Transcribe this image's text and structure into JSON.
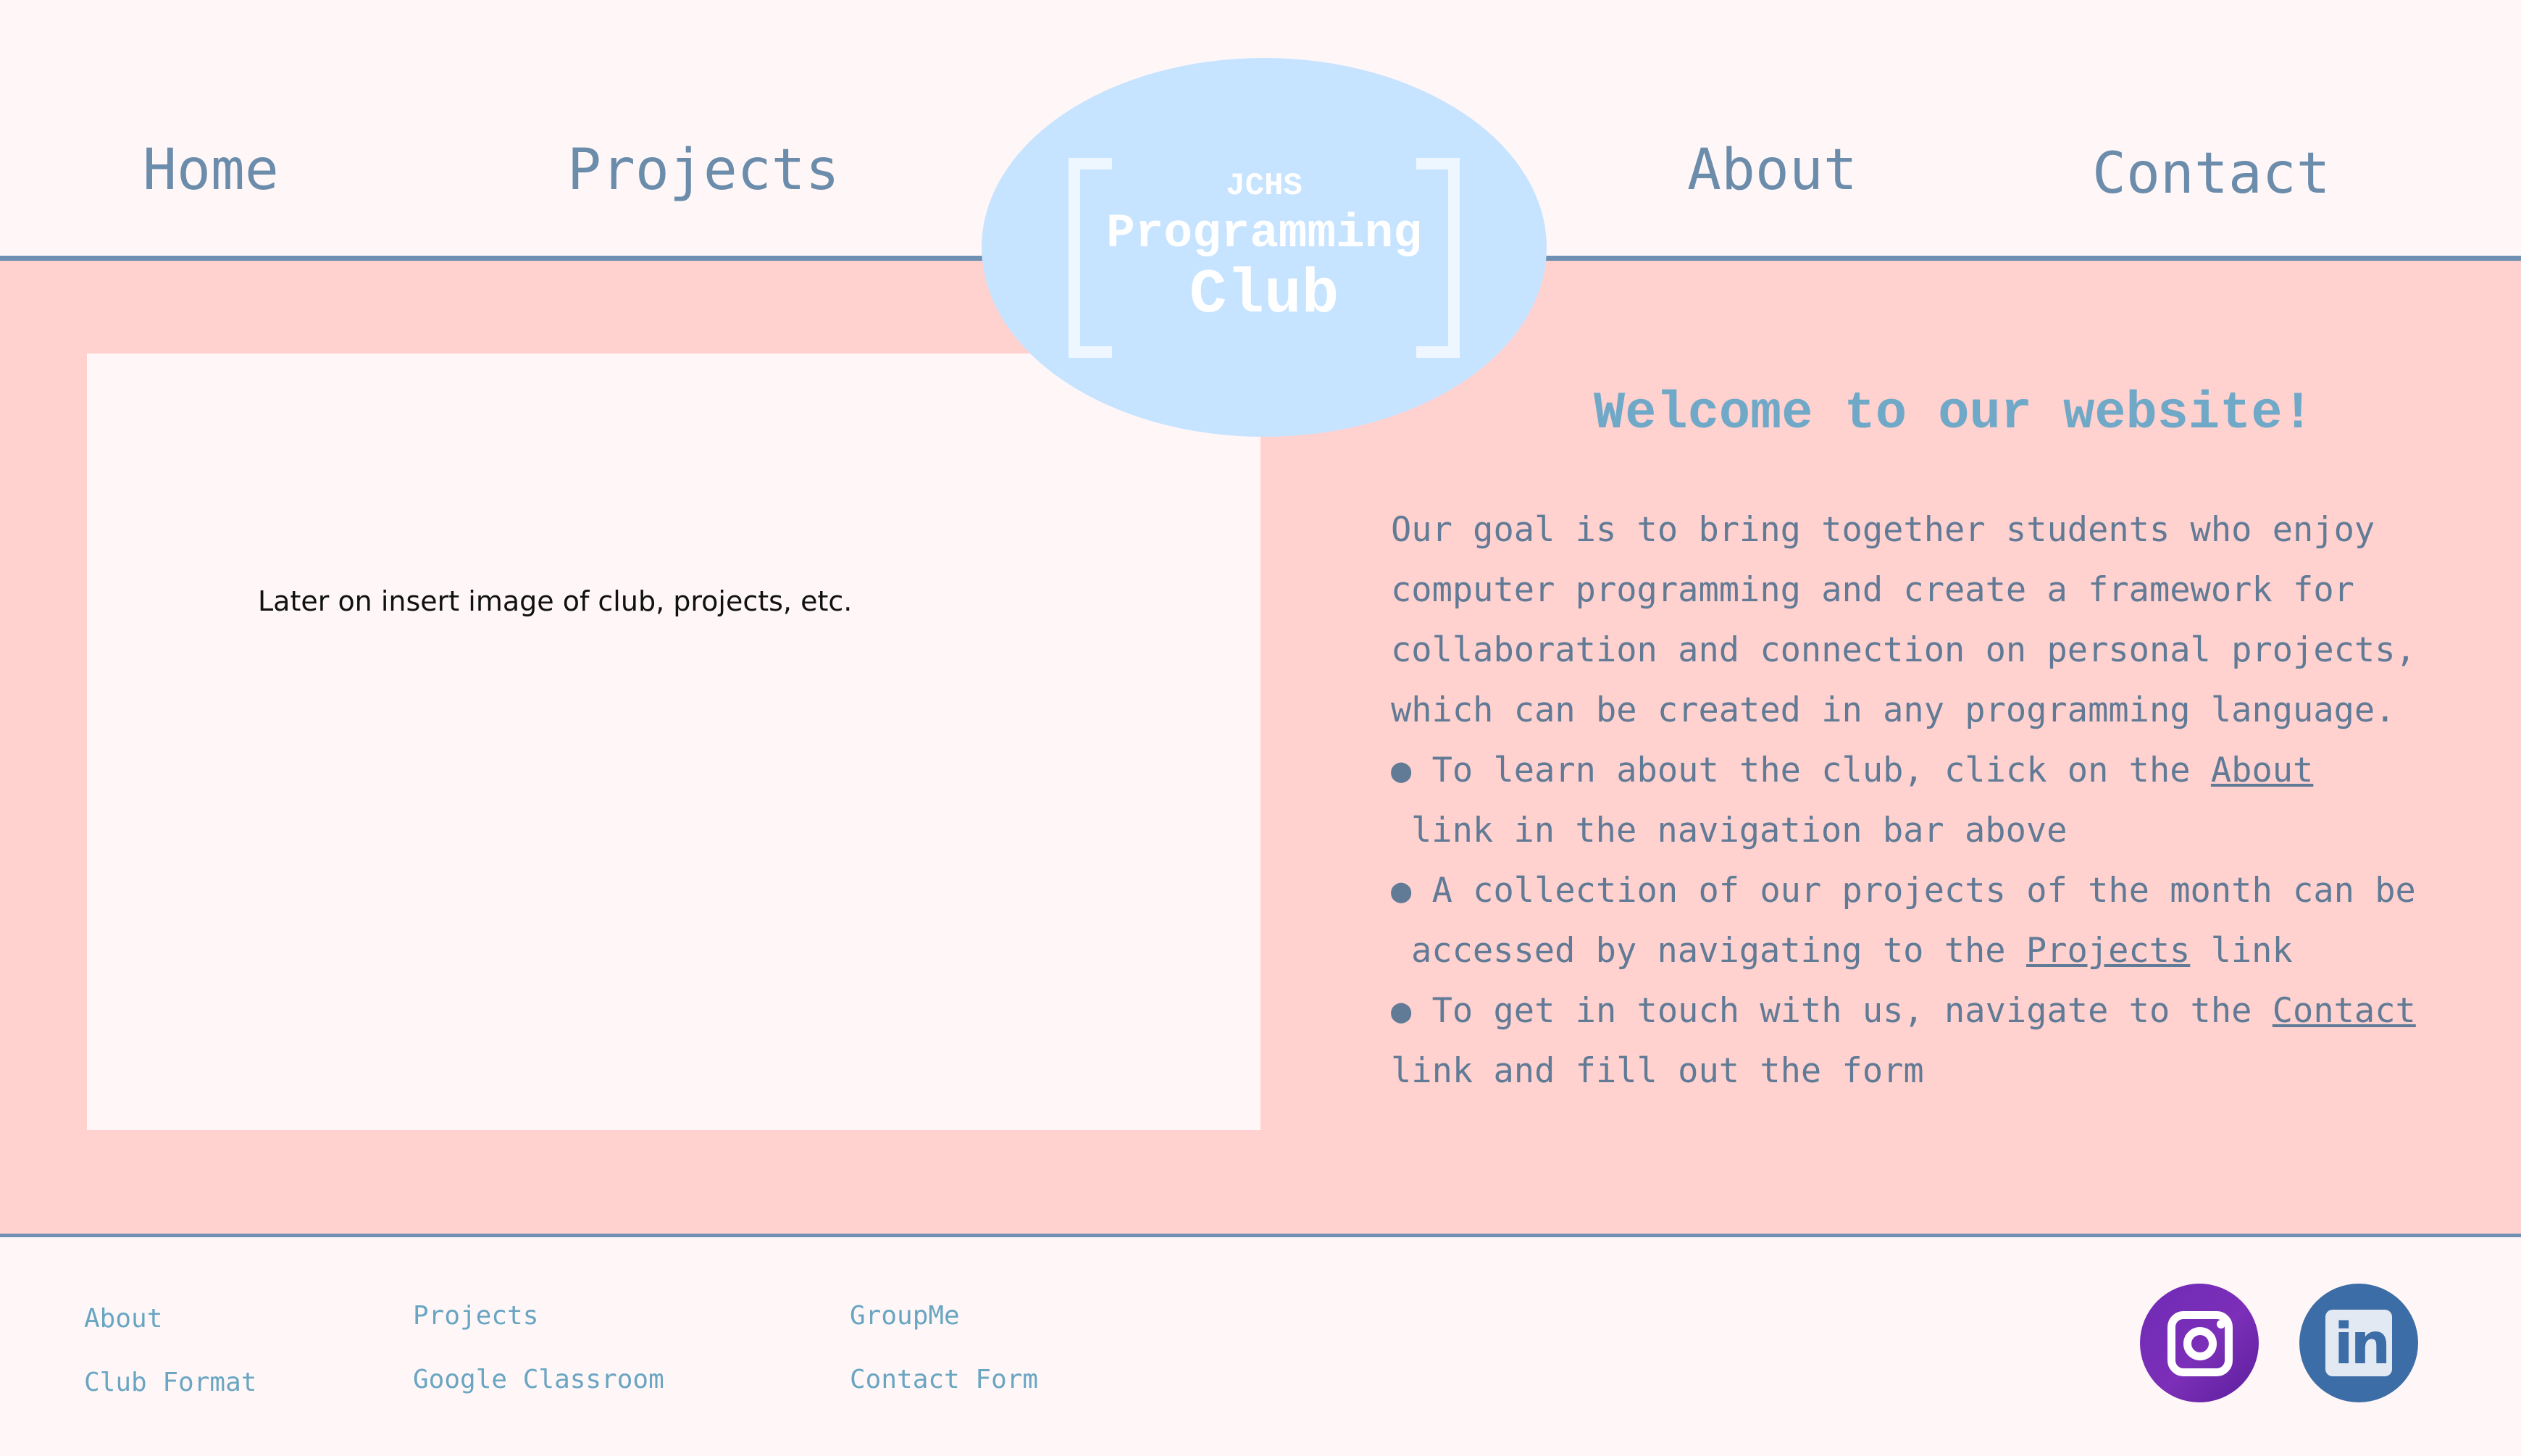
{
  "nav": {
    "home": "Home",
    "projects": "Projects",
    "about": "About",
    "contact": "Contact"
  },
  "logo": {
    "line1": "JCHS",
    "line2": "Programming",
    "line3": "Club"
  },
  "image_placeholder": "Later on insert image of club, projects, etc.",
  "welcome": {
    "title": "Welcome to our website!",
    "intro": "Our goal is to bring together students who enjoy computer programming and create a framework for collaboration and connection on personal projects, which can be created in any programming language.",
    "bullet1_before": "● To learn about the club, click on the ",
    "bullet1_link": "About",
    "bullet1_after": "link in the navigation bar above",
    "bullet2_before": "● A collection of our projects of the month can be",
    "bullet2_cont": "accessed by navigating to the ",
    "bullet2_link": "Projects",
    "bullet2_after": " link",
    "bullet3_before": "● To get in touch with us, navigate to the ",
    "bullet3_link": "Contact",
    "bullet3_after": "link and fill out the form"
  },
  "footer": {
    "col1": [
      "About",
      "Club Format"
    ],
    "col2": [
      "Projects",
      "Google Classroom"
    ],
    "col3": [
      "GroupMe",
      "Contact Form"
    ]
  },
  "social": {
    "instagram": "instagram-icon",
    "linkedin": "linkedin-icon",
    "linkedin_text": "in"
  },
  "colors": {
    "background": "#fff7f7",
    "band": "#ffd1cf",
    "nav_text": "#6c8cab",
    "accent_line": "#6f8fb3",
    "logo_bg": "#c6e3ff",
    "welcome_title": "#6fa9c7",
    "footer_link": "#6aa5c2"
  }
}
